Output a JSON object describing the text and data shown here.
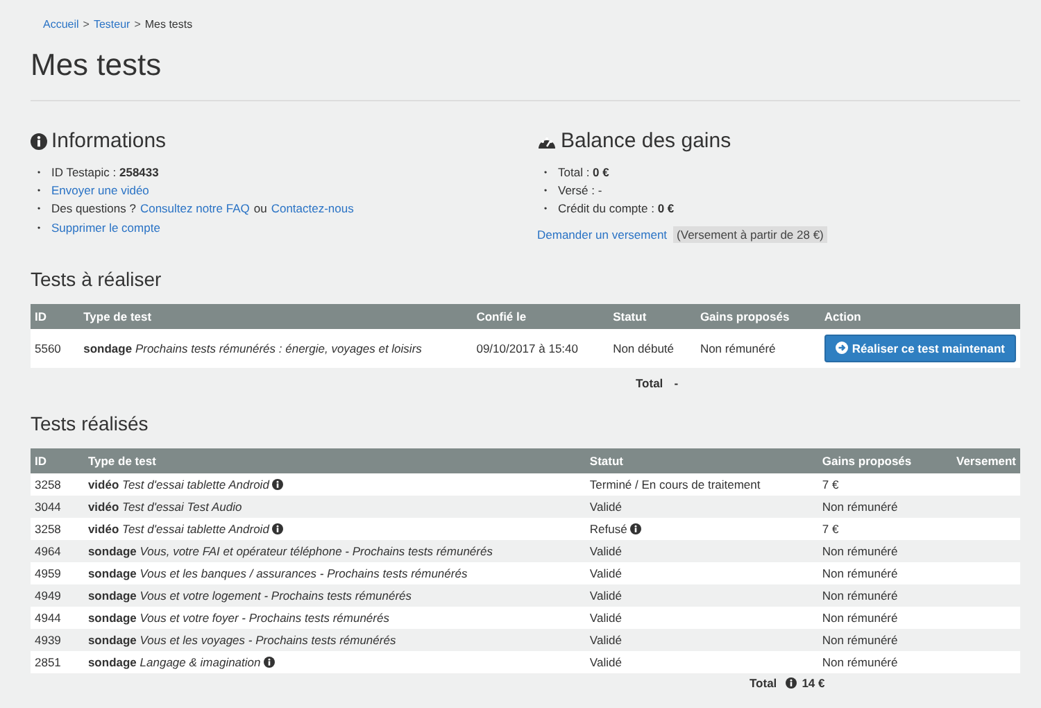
{
  "breadcrumb": [
    {
      "label": "Accueil",
      "link": true
    },
    {
      "separator": ">",
      "label": "Testeur",
      "link": true
    },
    {
      "separator": ">",
      "label": "Mes tests",
      "link": false
    }
  ],
  "title": "Mes tests",
  "informations": {
    "heading": "Informations",
    "items": [
      {
        "marker": "•",
        "parts": [
          {
            "text": "ID Testapic : **258433**",
            "link": false
          }
        ]
      },
      {
        "marker": "•",
        "parts": [
          {
            "text": "Envoyer une vidéo",
            "link": true
          }
        ]
      },
      {
        "marker": "•",
        "parts": [
          {
            "text": "Des questions ?",
            "link": false
          },
          {
            "text": "Consultez notre FAQ",
            "link": true
          },
          {
            "text": "ou",
            "link": false
          },
          {
            "text": "Contactez-nous",
            "link": true
          }
        ]
      },
      {
        "marker": "•",
        "parts": [
          {
            "text": "Supprimer le compte",
            "link": true
          }
        ]
      }
    ]
  },
  "balance": {
    "heading": "Balance des gains",
    "items": [
      {
        "marker": "•",
        "text": "Total : **0 €**"
      },
      {
        "marker": "•",
        "text": "Versé : -"
      },
      {
        "marker": "•",
        "text": "Crédit du compte : **0 €**"
      }
    ],
    "request_link": "Demander un versement",
    "request_note": "(Versement à partir de 28 €)"
  },
  "todo": {
    "heading": "Tests à réaliser",
    "columns": [
      "ID",
      "Type de test",
      "Confié le",
      "Statut",
      "Gains proposés",
      "Action"
    ],
    "rows": [
      {
        "id": "5560",
        "category": "sondage",
        "title": "Prochains tests rémunérés : énergie, voyages et loisirs",
        "date": "09/10/2017 à 15:40",
        "status": "Non débuté",
        "gains": "Non rémunéré",
        "action": "Réaliser ce test maintenant"
      }
    ],
    "total_label": "Total",
    "total_value": "-"
  },
  "done": {
    "heading": "Tests réalisés",
    "columns": [
      "ID",
      "Type de test",
      "Statut",
      "Gains proposés",
      "Versement"
    ],
    "rows": [
      {
        "id": "3258",
        "category": "vidéo",
        "title": "Test d'essai tablette Android",
        "info": true,
        "status": "Terminé / En cours de traitement",
        "status_info": false,
        "gains": "7 €"
      },
      {
        "id": "3044",
        "category": "vidéo",
        "title": "Test d'essai Test Audio",
        "info": false,
        "status": "Validé",
        "status_info": false,
        "gains": "Non rémunéré"
      },
      {
        "id": "3258",
        "category": "vidéo",
        "title": "Test d'essai tablette Android",
        "info": true,
        "status": "Refusé",
        "status_info": true,
        "gains": "7 €"
      },
      {
        "id": "4964",
        "category": "sondage",
        "title": "Vous, votre FAI et opérateur téléphone - Prochains tests rémunérés",
        "info": false,
        "status": "Validé",
        "status_info": false,
        "gains": "Non rémunéré"
      },
      {
        "id": "4959",
        "category": "sondage",
        "title": "Vous et les banques / assurances - Prochains tests rémunérés",
        "info": false,
        "status": "Validé",
        "status_info": false,
        "gains": "Non rémunéré"
      },
      {
        "id": "4949",
        "category": "sondage",
        "title": "Vous et votre logement - Prochains tests rémunérés",
        "info": false,
        "status": "Validé",
        "status_info": false,
        "gains": "Non rémunéré"
      },
      {
        "id": "4944",
        "category": "sondage",
        "title": "Vous et votre foyer - Prochains tests rémunérés",
        "info": false,
        "status": "Validé",
        "status_info": false,
        "gains": "Non rémunéré"
      },
      {
        "id": "4939",
        "category": "sondage",
        "title": "Vous et les voyages - Prochains tests rémunérés",
        "info": false,
        "status": "Validé",
        "status_info": false,
        "gains": "Non rémunéré"
      },
      {
        "id": "2851",
        "category": "sondage",
        "title": "Langage & imagination",
        "info": true,
        "status": "Validé",
        "status_info": false,
        "gains": "Non rémunéré"
      }
    ],
    "total_label": "Total",
    "total_value": "14 €"
  }
}
